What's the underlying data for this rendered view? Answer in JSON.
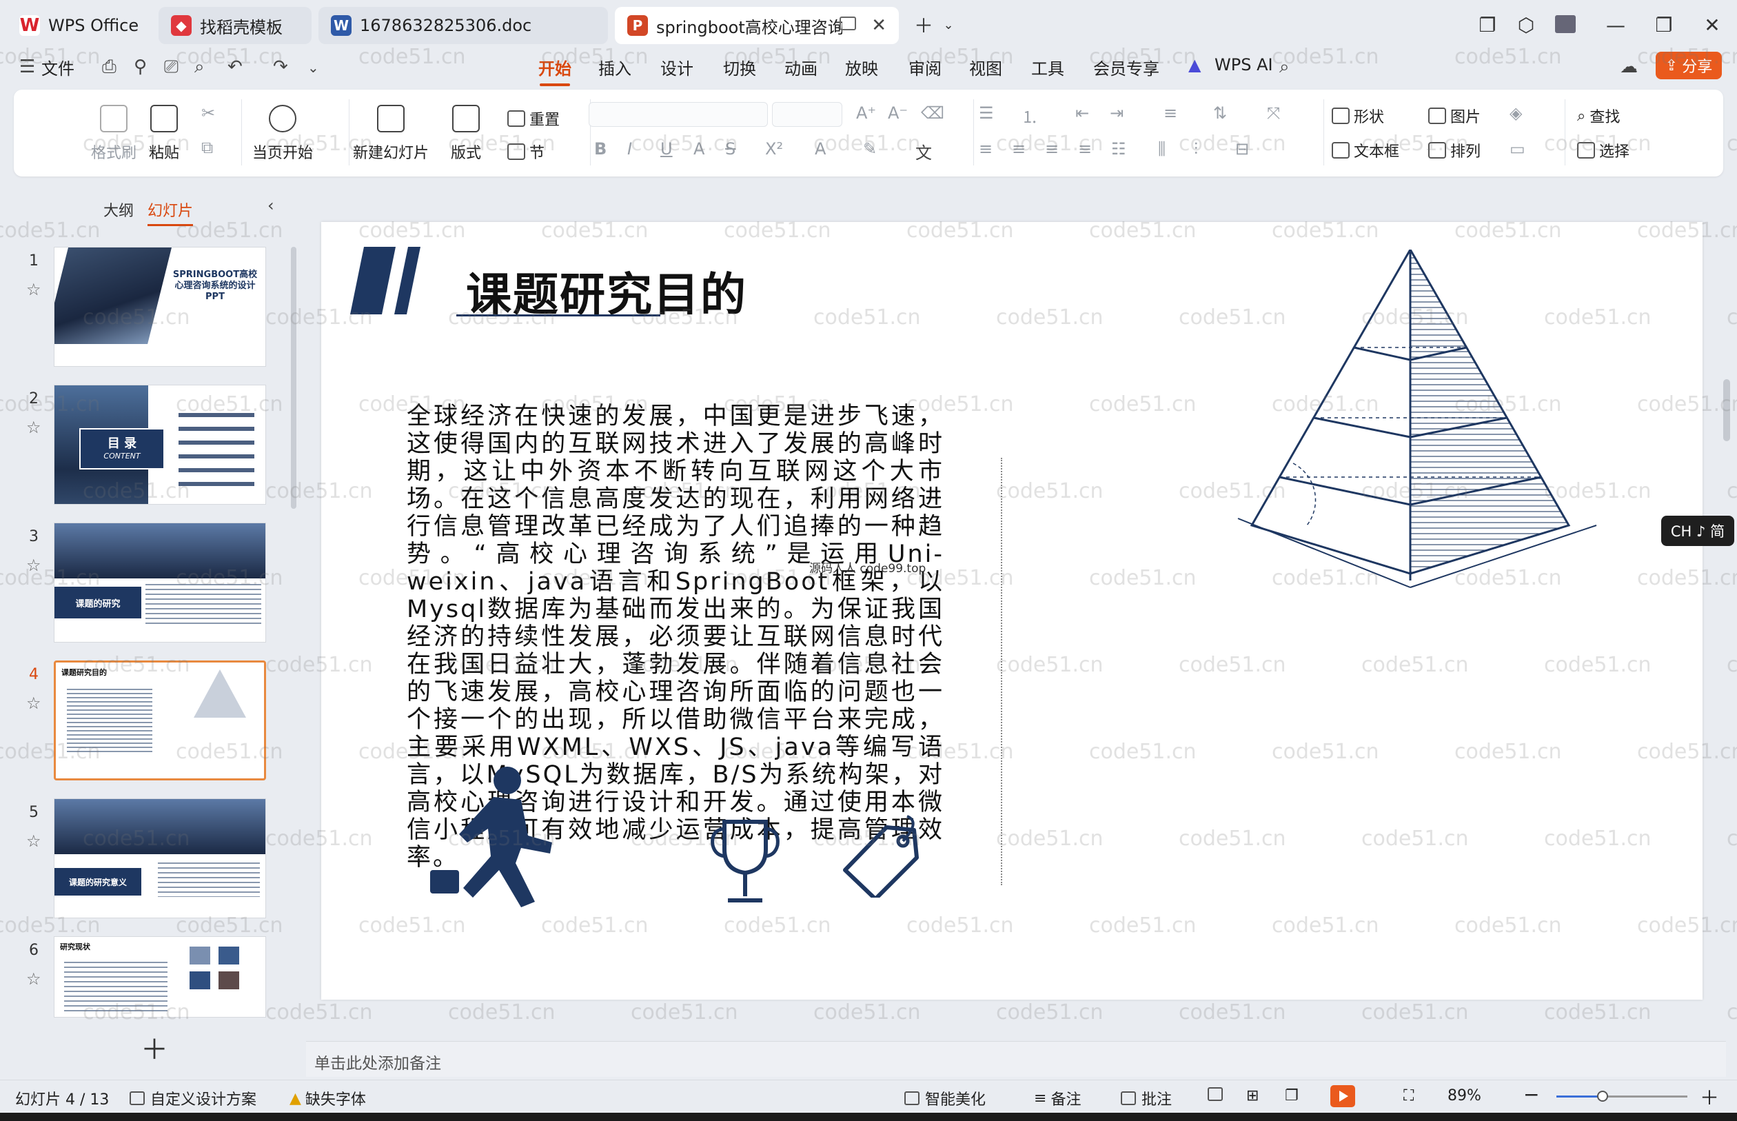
{
  "tabs": [
    {
      "label": "WPS Office",
      "icon": "wps-logo-icon",
      "color": "#d9232d"
    },
    {
      "label": "找稻壳模板",
      "icon": "docer-icon",
      "color": "#e0383e"
    },
    {
      "label": "1678632825306.doc",
      "icon": "word-doc-icon",
      "color": "#2f5aa8"
    },
    {
      "label": "springboot高校心理咨询系统",
      "icon": "ppt-doc-icon",
      "color": "#d24726"
    }
  ],
  "menu": {
    "file": "文件",
    "items": [
      "开始",
      "插入",
      "设计",
      "切换",
      "动画",
      "放映",
      "审阅",
      "视图",
      "工具",
      "会员专享"
    ],
    "active": "开始",
    "wps_ai": "WPS AI",
    "share": "分享"
  },
  "ribbon": {
    "format_painter": "格式刷",
    "paste": "粘贴",
    "play_from_current": "当页开始",
    "new_slide": "新建幻灯片",
    "layout": "版式",
    "reset": "重置",
    "section": "节",
    "shape": "形状",
    "picture": "图片",
    "find": "查找",
    "textbox": "文本框",
    "arrange": "排列",
    "select": "选择"
  },
  "left_panel": {
    "tab_outline": "大纲",
    "tab_slides": "幻灯片",
    "selected": 4,
    "slides": [
      {
        "num": "1",
        "title": "SPRINGBOOT高校心理咨询系统的设计PPT"
      },
      {
        "num": "2",
        "title": "目 录",
        "subtitle": "CONTENT"
      },
      {
        "num": "3",
        "title": "课题的研究"
      },
      {
        "num": "4",
        "title": "课题研究目的"
      },
      {
        "num": "5",
        "title": "课题的研究意义"
      },
      {
        "num": "6",
        "title": "研究现状"
      }
    ]
  },
  "slide": {
    "title": "课题研究目的",
    "body": "全球经济在快速的发展，中国更是进步飞速，这使得国内的互联网技术进入了发展的高峰时期，这让中外资本不断转向互联网这个大市场。在这个信息高度发达的现在，利用网络进行信息管理改革已经成为了人们追捧的一种趋势。“高校心理咨询系统”是运用Uni-weixin、java语言和SpringBoot框架，以Mysql数据库为基础而发出来的。为保证我国经济的持续性发展，必须要让互联网信息时代在我国日益壮大，蓬勃发展。伴随着信息社会的飞速发展，高校心理咨询所面临的问题也一个接一个的出现，所以借助微信平台来完成，主要采用WXML、WXS、JS、java等编写语言，以MySQL为数据库，B/S为系统构架，对高校心理咨询进行设计和开发。通过使用本微信小程序可有效地减少运营成本，提高管理效率。",
    "source_tag": "源码人人 code99.top",
    "accent": "#1e3761"
  },
  "notes_placeholder": "单击此处添加备注",
  "ime": "CH ♪ 简",
  "status": {
    "slide_counter": "幻灯片 4 / 13",
    "design_scheme": "自定义设计方案",
    "missing_font": "缺失字体",
    "beautify": "智能美化",
    "notes": "备注",
    "comments": "批注",
    "zoom": "89%",
    "zoom_fraction": 0.35
  },
  "watermark": "code51.cn"
}
